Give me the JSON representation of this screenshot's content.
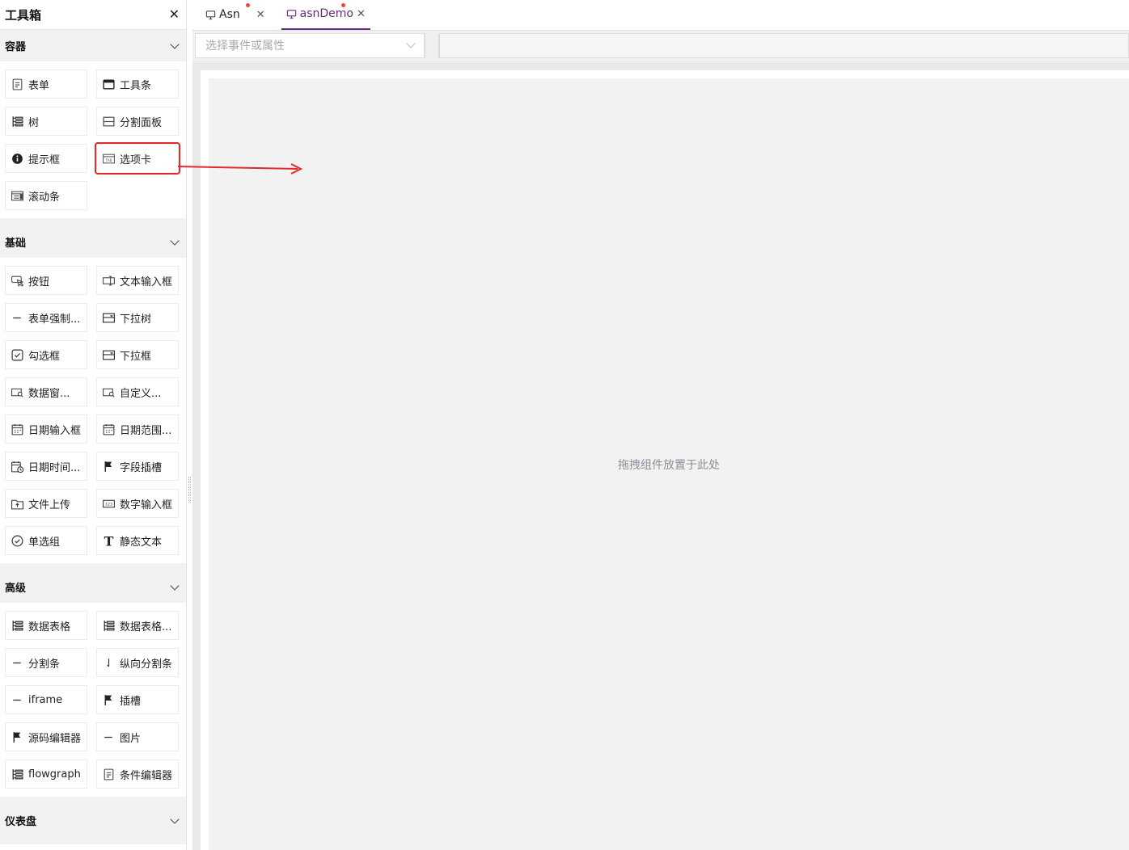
{
  "toolbox": {
    "title": "工具箱",
    "sections": [
      {
        "label": "容器",
        "items": [
          {
            "label": "表单",
            "icon": "form-icon"
          },
          {
            "label": "工具条",
            "icon": "toolbar-icon"
          },
          {
            "label": "树",
            "icon": "tree-icon"
          },
          {
            "label": "分割面板",
            "icon": "split-panel-icon"
          },
          {
            "label": "提示框",
            "icon": "info-icon"
          },
          {
            "label": "选项卡",
            "icon": "tab-icon"
          },
          {
            "label": "滚动条",
            "icon": "scrollbar-icon"
          }
        ]
      },
      {
        "label": "基础",
        "items": [
          {
            "label": "按钮",
            "icon": "button-icon"
          },
          {
            "label": "文本输入框",
            "icon": "text-input-icon"
          },
          {
            "label": "表单强制...",
            "icon": "dash-icon"
          },
          {
            "label": "下拉树",
            "icon": "dropdown-icon"
          },
          {
            "label": "勾选框",
            "icon": "checkbox-icon"
          },
          {
            "label": "下拉框",
            "icon": "dropdown-icon"
          },
          {
            "label": "数据窗...",
            "icon": "data-window-icon"
          },
          {
            "label": "自定义...",
            "icon": "data-window-icon"
          },
          {
            "label": "日期输入框",
            "icon": "calendar-icon"
          },
          {
            "label": "日期范围...",
            "icon": "calendar-icon"
          },
          {
            "label": "日期时间...",
            "icon": "calendar-clock-icon"
          },
          {
            "label": "字段插槽",
            "icon": "flag-icon"
          },
          {
            "label": "文件上传",
            "icon": "upload-icon"
          },
          {
            "label": "数字输入框",
            "icon": "number-input-icon"
          },
          {
            "label": "单选组",
            "icon": "radio-icon"
          },
          {
            "label": "静态文本",
            "icon": "text-t-icon"
          }
        ]
      },
      {
        "label": "高级",
        "items": [
          {
            "label": "数据表格",
            "icon": "tree-icon"
          },
          {
            "label": "数据表格...",
            "icon": "tree-icon"
          },
          {
            "label": "分割条",
            "icon": "dash-icon"
          },
          {
            "label": "纵向分割条",
            "icon": "vertical-split-icon"
          },
          {
            "label": "iframe",
            "icon": "dash-icon"
          },
          {
            "label": "插槽",
            "icon": "flag-icon"
          },
          {
            "label": "源码编辑器",
            "icon": "flag-icon"
          },
          {
            "label": "图片",
            "icon": "dash-icon"
          },
          {
            "label": "flowgraph",
            "icon": "tree-icon"
          },
          {
            "label": "条件编辑器",
            "icon": "form-icon"
          }
        ]
      },
      {
        "label": "仪表盘",
        "items": []
      }
    ]
  },
  "tabs": [
    {
      "label": "Asn",
      "active": false
    },
    {
      "label": "asnDemo",
      "active": true
    }
  ],
  "event_select": {
    "placeholder": "选择事件或属性"
  },
  "canvas": {
    "hint": "拖拽组件放置于此处"
  },
  "colors": {
    "accent": "#6b2a7a",
    "highlight": "#e12a2a",
    "dirty_dot": "#ee4444"
  }
}
